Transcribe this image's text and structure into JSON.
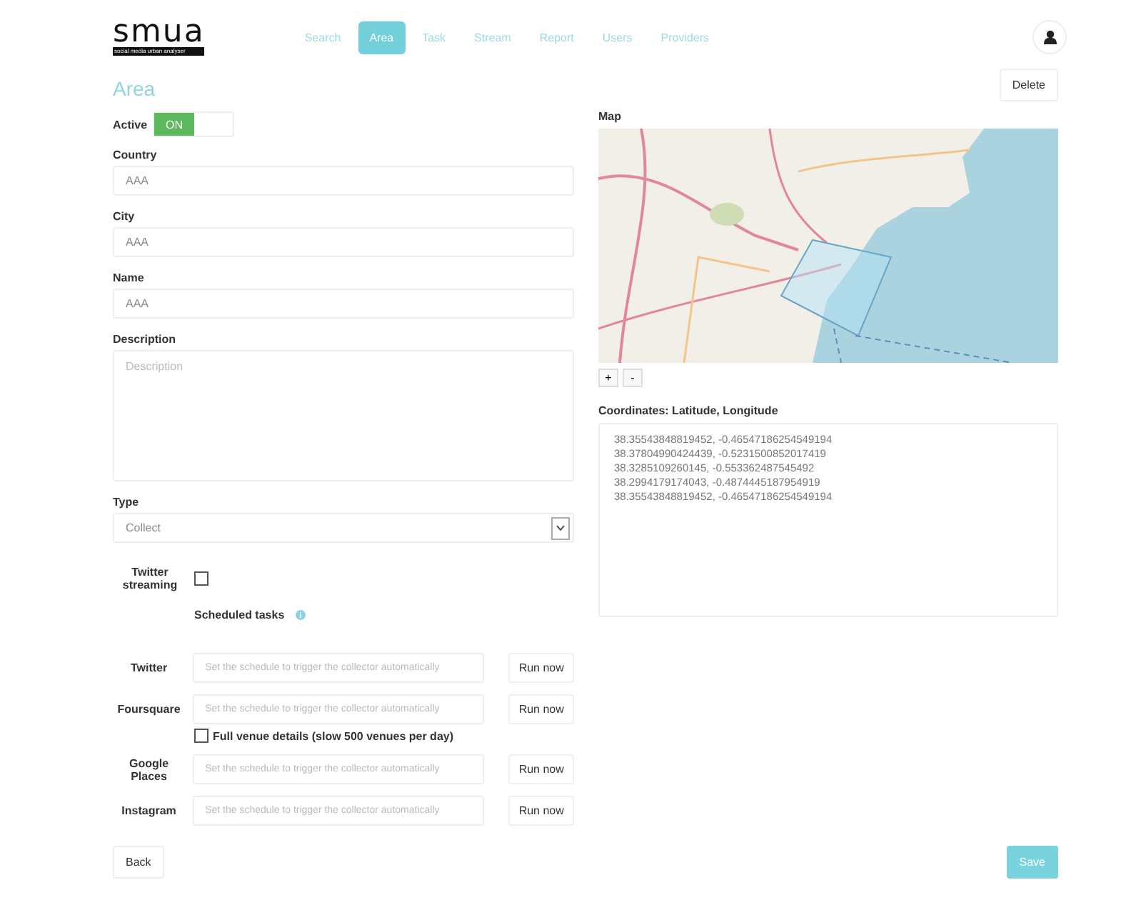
{
  "logo": {
    "title": "smua",
    "subtitle": "social media urban analyser"
  },
  "nav": [
    {
      "label": "Search",
      "selected": false
    },
    {
      "label": "Area",
      "selected": true
    },
    {
      "label": "Task",
      "selected": false
    },
    {
      "label": "Stream",
      "selected": false
    },
    {
      "label": "Report",
      "selected": false
    },
    {
      "label": "Users",
      "selected": false
    },
    {
      "label": "Providers",
      "selected": false
    }
  ],
  "page_title": "Area",
  "delete_button": "Delete",
  "active": {
    "label": "Active",
    "on": true,
    "text": "ON"
  },
  "fields": [
    {
      "label": "Country",
      "value": "AAA"
    },
    {
      "label": "City",
      "value": "AAA"
    },
    {
      "label": "Name",
      "value": "AAA"
    }
  ],
  "description": {
    "label": "Description",
    "placeholder": "Description"
  },
  "type": {
    "label": "Type",
    "value": "Collect"
  },
  "twitter_streaming": {
    "label": "Twitter streaming",
    "checked": false
  },
  "scheduled_tasks": {
    "title": "Scheduled tasks"
  },
  "schedules": [
    {
      "label": "Twitter",
      "placeholder": "Set the schedule to trigger the collector automatically",
      "button": "Run now"
    },
    {
      "label": "Foursquare",
      "placeholder": "Set the schedule to trigger the collector automatically",
      "button": "Run now",
      "option": {
        "label": "Full venue details (slow 500 venues per day)",
        "checked": false
      }
    },
    {
      "label": "Google Places",
      "placeholder": "Set the schedule to trigger the collector automatically",
      "button": "Run now"
    },
    {
      "label": "Instagram",
      "placeholder": "Set the schedule to trigger the collector automatically",
      "button": "Run now"
    }
  ],
  "map": {
    "label": "Map",
    "zoom_in": "+",
    "zoom_out": "-"
  },
  "coordinates": {
    "label": "Coordinates: Latitude, Longitude",
    "value": "38.35543848819452, -0.46547186254549194\n38.37804990424439, -0.5231500852017419\n38.3285109260145, -0.553362487545492\n38.2994179174043, -0.4874445187954919\n38.35543848819452, -0.46547186254549194"
  },
  "back_button": "Back",
  "save_button": "Save"
}
